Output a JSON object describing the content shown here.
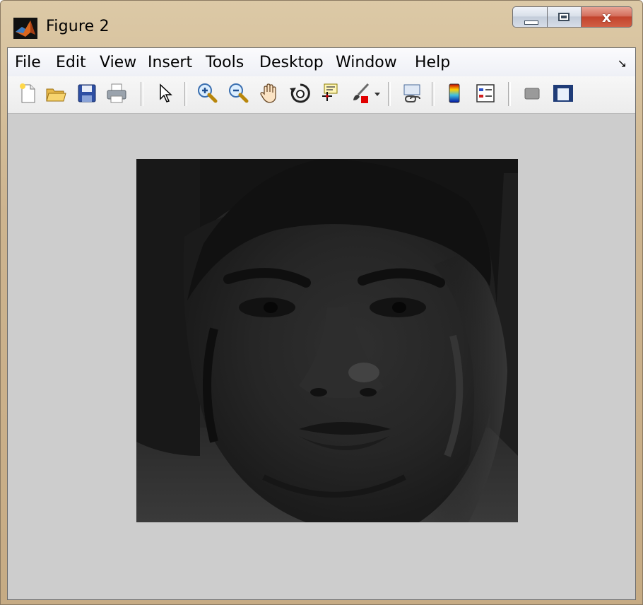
{
  "window": {
    "title": "Figure 2",
    "app_icon": "matlab-logo-icon",
    "controls": [
      "minimize-icon",
      "maximize-icon",
      "close-icon"
    ],
    "close_glyph": "x"
  },
  "menubar": {
    "items": [
      "File",
      "Edit",
      "View",
      "Insert",
      "Tools",
      "Desktop",
      "Window",
      "Help"
    ],
    "dock_glyph": "↘"
  },
  "toolbar": {
    "buttons": [
      "new-figure-icon",
      "open-file-icon",
      "save-figure-icon",
      "print-figure-icon",
      "edit-plot-cursor-icon",
      "zoom-in-icon",
      "zoom-out-icon",
      "pan-hand-icon",
      "rotate-3d-icon",
      "data-cursor-icon",
      "brush-icon",
      "brush-dropdown-icon",
      "link-plot-icon",
      "insert-colorbar-icon",
      "insert-legend-icon",
      "hide-plot-tools-icon",
      "show-plot-tools-icon"
    ]
  },
  "figure": {
    "background": "#cdcdcd",
    "image_content": "grayscale-face-photo"
  }
}
